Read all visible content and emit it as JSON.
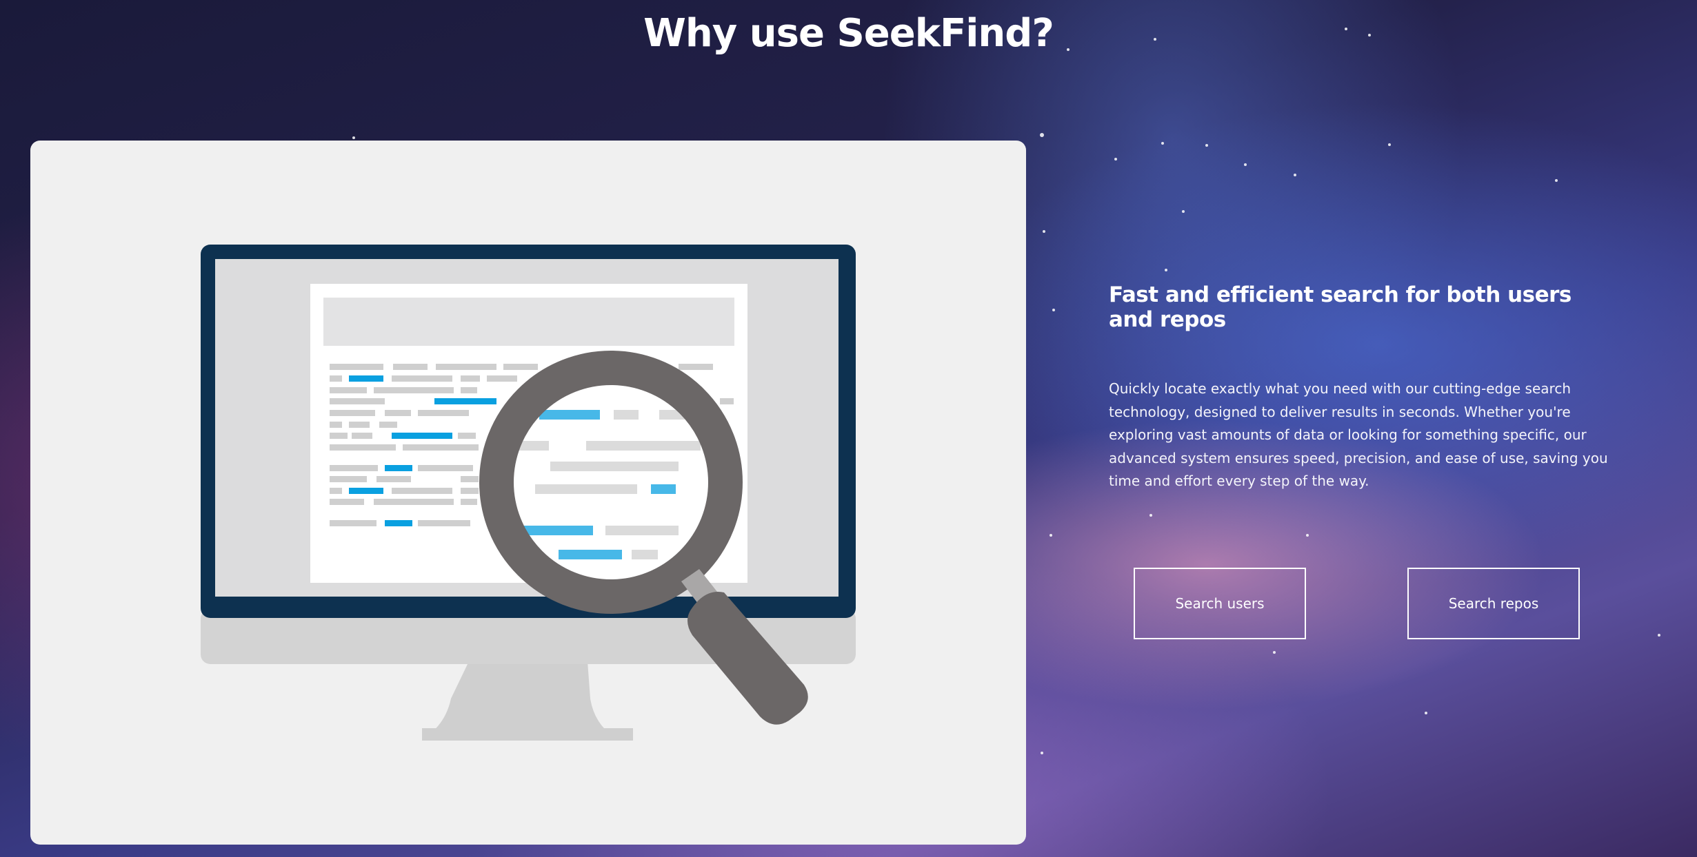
{
  "page": {
    "title": "Why use SeekFind?"
  },
  "feature": {
    "heading": "Fast and efficient search for both users and repos",
    "description": "Quickly locate exactly what you need with our cutting-edge search technology, designed to deliver results in seconds. Whether you're exploring vast amounts of data or looking for something specific, our advanced system ensures speed, precision, and ease of use, saving you time and effort every step of the way."
  },
  "actions": {
    "search_users_label": "Search users",
    "search_repos_label": "Search repos"
  },
  "illustration": {
    "icon": "monitor-magnifier-icon",
    "colors": {
      "monitor_frame": "#0d3150",
      "highlight": "#0aa0e0",
      "magnifier": "#6b6767",
      "placeholder": "#cfcfcf"
    }
  }
}
